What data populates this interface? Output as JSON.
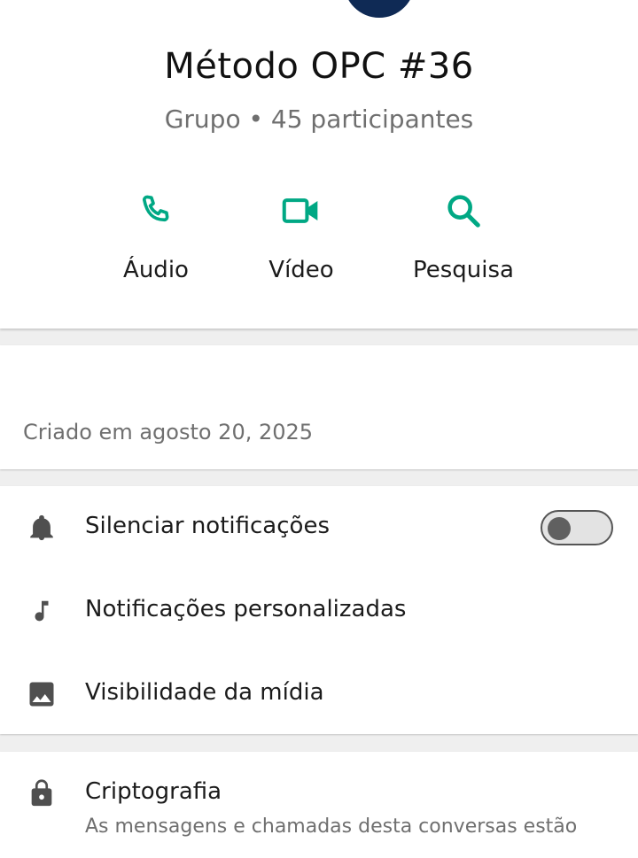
{
  "group": {
    "name": "Método OPC #36",
    "subtitle": "Grupo • 45 participantes"
  },
  "actions": [
    {
      "label": "Áudio",
      "icon": "phone-icon"
    },
    {
      "label": "Vídeo",
      "icon": "video-camera-icon"
    },
    {
      "label": "Pesquisa",
      "icon": "search-icon"
    }
  ],
  "info": {
    "created": "Criado em agosto 20, 2025"
  },
  "settings": [
    {
      "label": "Silenciar notificações",
      "icon": "bell-icon",
      "toggle": "off"
    },
    {
      "label": "Notificações personalizadas",
      "icon": "music-note-icon"
    },
    {
      "label": "Visibilidade da mídia",
      "icon": "image-icon"
    }
  ],
  "encryption": {
    "title": "Criptografia",
    "description": "As mensagens e chamadas desta conversas estão",
    "icon": "lock-icon"
  },
  "colors": {
    "accent": "#00a884",
    "icon_gray": "#4f4f4f",
    "avatar": "#0f2a55"
  }
}
